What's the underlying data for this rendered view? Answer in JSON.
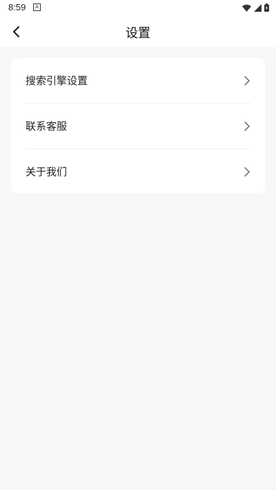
{
  "status_bar": {
    "time": "8:59",
    "notification_icon": "a-icon",
    "icons": [
      "wifi-icon",
      "signal-icon",
      "battery-icon"
    ]
  },
  "nav": {
    "title": "设置",
    "back_icon": "chevron-left-icon"
  },
  "settings": {
    "items": [
      {
        "label": "搜索引擎设置",
        "icon": "chevron-right-icon"
      },
      {
        "label": "联系客服",
        "icon": "chevron-right-icon"
      },
      {
        "label": "关于我们",
        "icon": "chevron-right-icon"
      }
    ]
  },
  "colors": {
    "background": "#f7f7f7",
    "card": "#ffffff",
    "text": "#222222",
    "divider": "#efefef",
    "chevron": "#666666"
  }
}
